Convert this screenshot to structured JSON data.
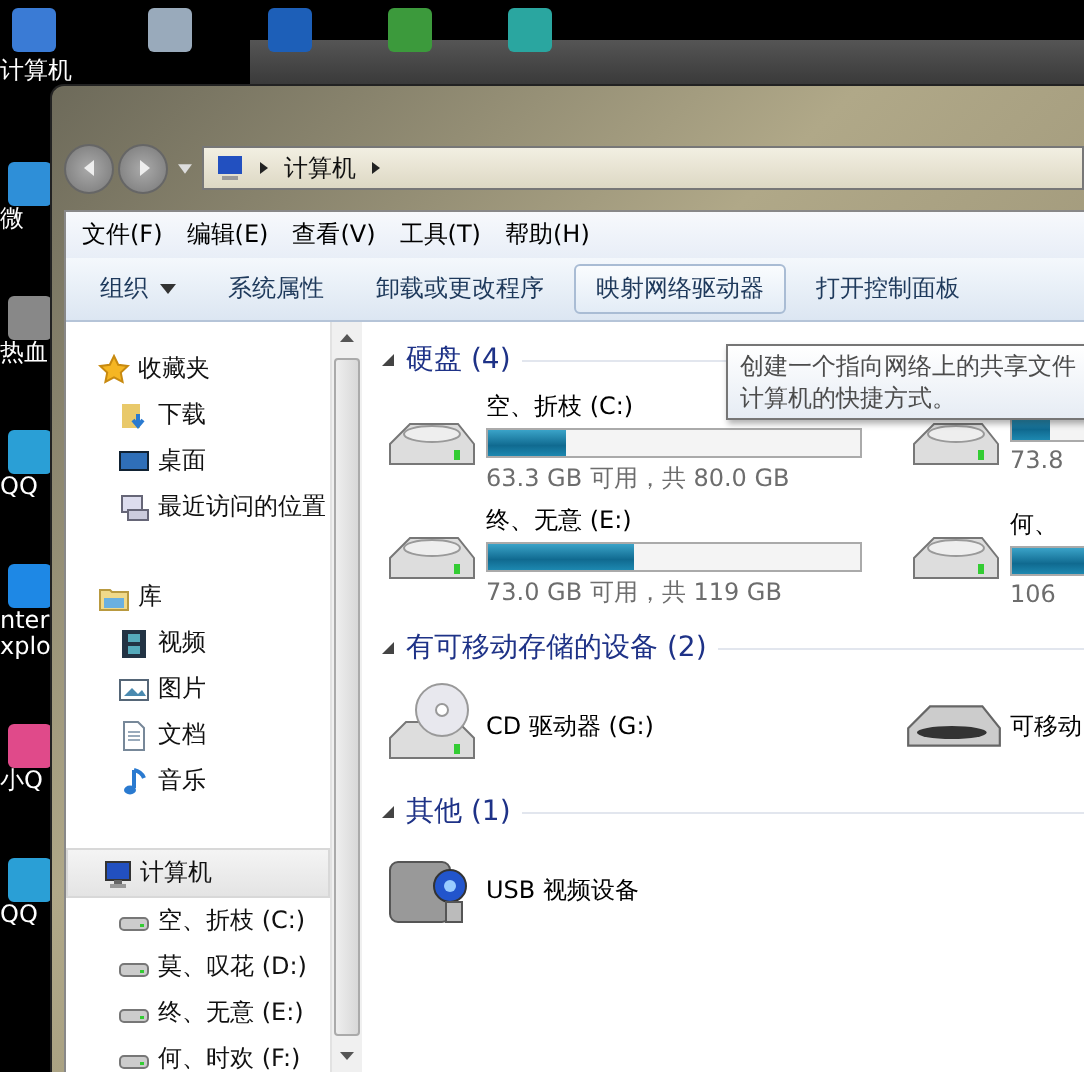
{
  "desktop": {
    "top_icons": [
      {
        "kind": "computer",
        "label": "计算机"
      },
      {
        "kind": "bin"
      },
      {
        "kind": "wps"
      },
      {
        "kind": "image"
      },
      {
        "kind": "whirl"
      }
    ],
    "left_icons": [
      {
        "kind": "weibo",
        "label": "微"
      },
      {
        "kind": "game",
        "label": "热血"
      },
      {
        "kind": "qqplayer",
        "label": "QQ"
      },
      {
        "kind": "ie",
        "label": "nter\nxplo"
      },
      {
        "kind": "qqpet",
        "label": "小Q"
      },
      {
        "kind": "qqplayer",
        "label": "QQ"
      }
    ]
  },
  "window": {
    "address": [
      "计算机"
    ],
    "menu": [
      "文件(F)",
      "编辑(E)",
      "查看(V)",
      "工具(T)",
      "帮助(H)"
    ],
    "toolbar": [
      {
        "label": "组织",
        "dropdown": true,
        "selected": false
      },
      {
        "label": "系统属性",
        "dropdown": false,
        "selected": false
      },
      {
        "label": "卸载或更改程序",
        "dropdown": false,
        "selected": false
      },
      {
        "label": "映射网络驱动器",
        "dropdown": false,
        "selected": true
      },
      {
        "label": "打开控制面板",
        "dropdown": false,
        "selected": false
      }
    ],
    "nav": [
      {
        "kind": "star",
        "label": "收藏夹",
        "selected": false,
        "children": [
          {
            "kind": "download",
            "label": "下载",
            "selected": false
          },
          {
            "kind": "desktop",
            "label": "桌面",
            "selected": false
          },
          {
            "kind": "recent",
            "label": "最近访问的位置",
            "selected": false
          }
        ]
      },
      {
        "kind": "library",
        "label": "库",
        "selected": false,
        "children": [
          {
            "kind": "video",
            "label": "视频",
            "selected": false
          },
          {
            "kind": "picture",
            "label": "图片",
            "selected": false
          },
          {
            "kind": "document",
            "label": "文档",
            "selected": false
          },
          {
            "kind": "music",
            "label": "音乐",
            "selected": false
          }
        ]
      },
      {
        "kind": "computer",
        "label": "计算机",
        "selected": true,
        "children": [
          {
            "kind": "drive",
            "label": "空、折枝 (C:)",
            "selected": false
          },
          {
            "kind": "drive",
            "label": "莫、叹花 (D:)",
            "selected": false
          },
          {
            "kind": "drive",
            "label": "终、无意 (E:)",
            "selected": false
          },
          {
            "kind": "drive",
            "label": "何、时欢 (F:)",
            "selected": false
          }
        ]
      }
    ],
    "groups": [
      {
        "title": "硬盘 (4)",
        "items": [
          {
            "kind": "disk",
            "name": "空、折枝 (C:)",
            "level": 0.21,
            "free": "63.3 GB 可用，共 80.0 GB"
          },
          {
            "kind": "disk",
            "level": 0.1,
            "free": "73.8"
          },
          {
            "kind": "disk",
            "name": "终、无意 (E:)",
            "level": 0.39,
            "free": "73.0 GB 可用，共 119 GB"
          },
          {
            "kind": "disk",
            "name": "何、",
            "level": 0.6,
            "free": "106"
          }
        ]
      },
      {
        "title": "有可移动存储的设备 (2)",
        "items": [
          {
            "kind": "cd",
            "name": "CD 驱动器 (G:)"
          },
          {
            "kind": "removable",
            "name": "可移动"
          }
        ]
      },
      {
        "title": "其他 (1)",
        "items": [
          {
            "kind": "camera",
            "name": "USB 视频设备"
          }
        ]
      }
    ],
    "tooltip": [
      "创建一个指向网络上的共享文件",
      "计算机的快捷方式。"
    ]
  }
}
